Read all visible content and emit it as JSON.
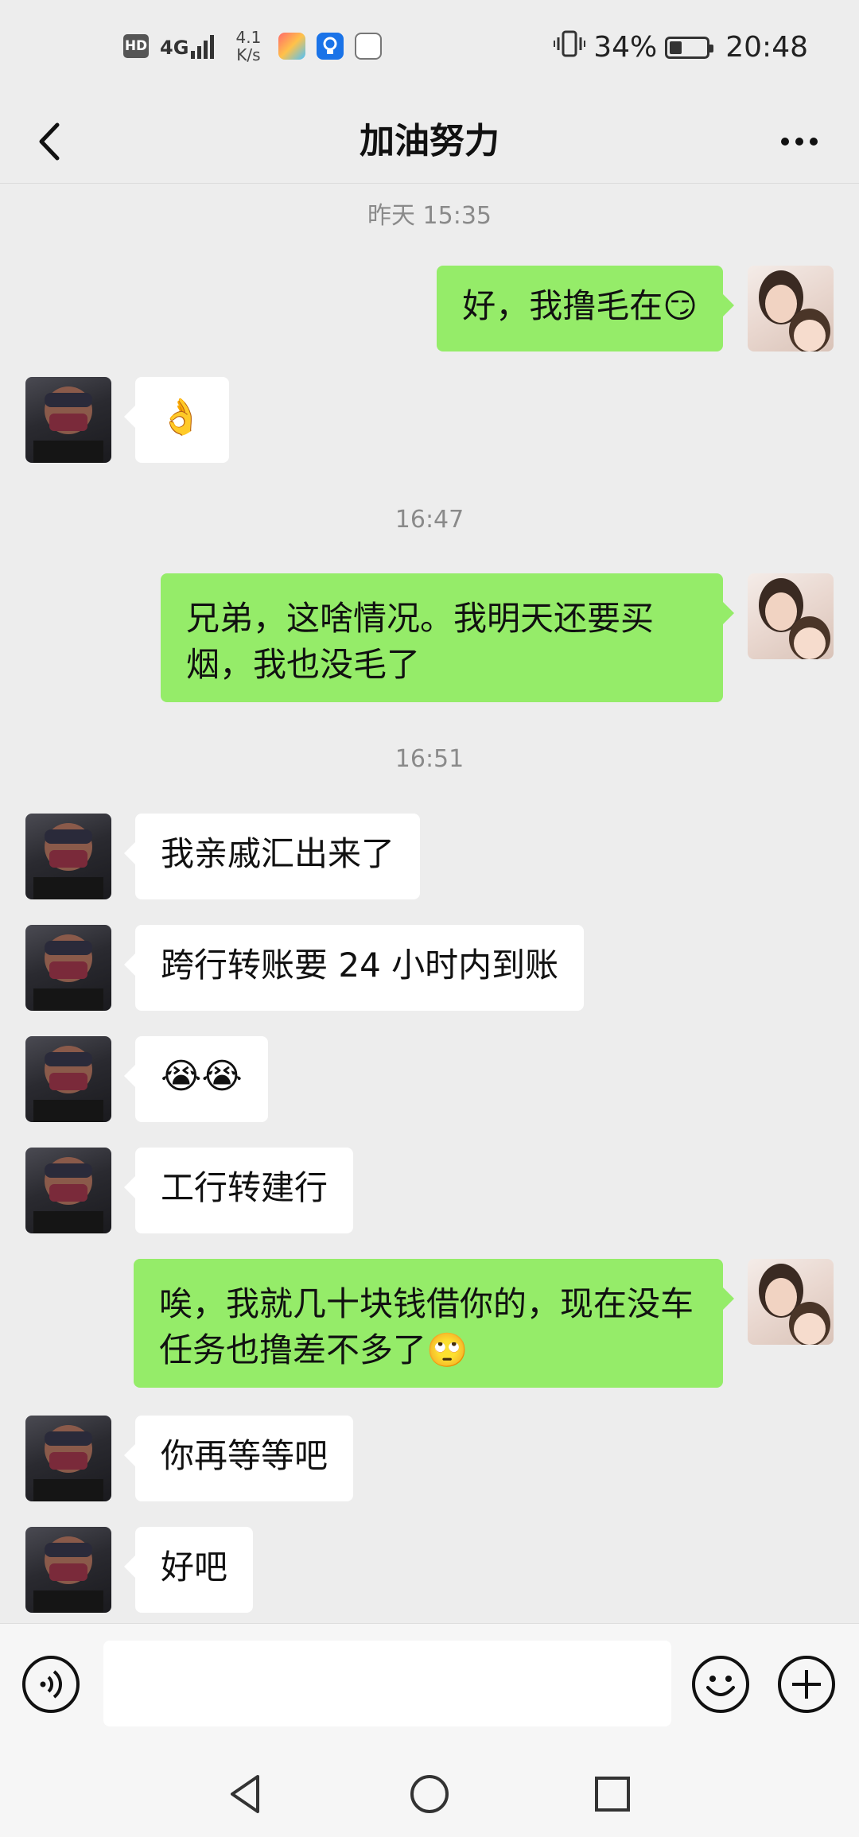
{
  "status_bar": {
    "hd_label": "HD",
    "signal_label": "4G",
    "speed_value": "4.1",
    "speed_unit": "K/s",
    "battery_percent": "34%",
    "battery_level": 0.34,
    "time": "20:48"
  },
  "header": {
    "title": "加油努力",
    "back_icon": "chevron-left-icon",
    "more_icon": "more-horizontal-icon"
  },
  "messages": {
    "ts1": "昨天 15:35",
    "m1": "好，我撸毛在😏",
    "m2": "👌",
    "ts2": "16:47",
    "m3": "兄弟，这啥情况。我明天还要买烟，我也没毛了",
    "ts3": "16:51",
    "m4": "我亲戚汇出来了",
    "m5": "跨行转账要 24 小时内到账",
    "m6": "😭😭",
    "m7": "工行转建行",
    "m8": "唉，我就几十块钱借你的，现在没车任务也撸差不多了🙄",
    "m9": "你再等等吧",
    "m10": "好吧"
  },
  "input_bar": {
    "voice_icon": "voice-icon",
    "emoji_icon": "emoji-icon",
    "plus_icon": "plus-icon",
    "placeholder": ""
  },
  "nav_bar": {
    "back_icon": "nav-back-icon",
    "home_icon": "nav-home-icon",
    "recents_icon": "nav-recents-icon"
  },
  "colors": {
    "outgoing_bubble": "#95ec69",
    "incoming_bubble": "#ffffff",
    "background": "#ededed"
  }
}
